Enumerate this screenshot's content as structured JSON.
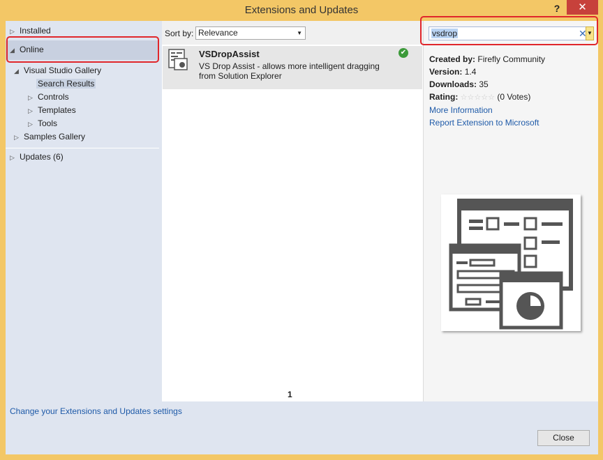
{
  "window": {
    "title": "Extensions and Updates",
    "help": "?",
    "close": "✕"
  },
  "sidebar": {
    "installed": "Installed",
    "online": "Online",
    "visual_studio_gallery": "Visual Studio Gallery",
    "search_results": "Search Results",
    "controls": "Controls",
    "templates": "Templates",
    "tools": "Tools",
    "samples_gallery": "Samples Gallery",
    "updates": "Updates (6)"
  },
  "sort": {
    "label": "Sort by:",
    "value": "Relevance"
  },
  "results": [
    {
      "name": "VSDropAssist",
      "description": "VS Drop Assist - allows more intelligent dragging from Solution Explorer",
      "installed_icon": "checkmark-icon"
    }
  ],
  "pagination": {
    "current": "1"
  },
  "search": {
    "value": "vsdrop"
  },
  "details": {
    "created_by_label": "Created by:",
    "created_by": "Firefly Community",
    "version_label": "Version:",
    "version": "1.4",
    "downloads_label": "Downloads:",
    "downloads": "35",
    "rating_label": "Rating:",
    "rating_stars": "☆☆☆☆☆",
    "rating_votes": "(0 Votes)",
    "more_info": "More Information",
    "report": "Report Extension to Microsoft"
  },
  "footer": {
    "settings_link": "Change your Extensions and Updates settings",
    "close": "Close"
  },
  "colors": {
    "highlight": "#e0262b",
    "link": "#1e5aa8",
    "accent": "#f3c766"
  }
}
